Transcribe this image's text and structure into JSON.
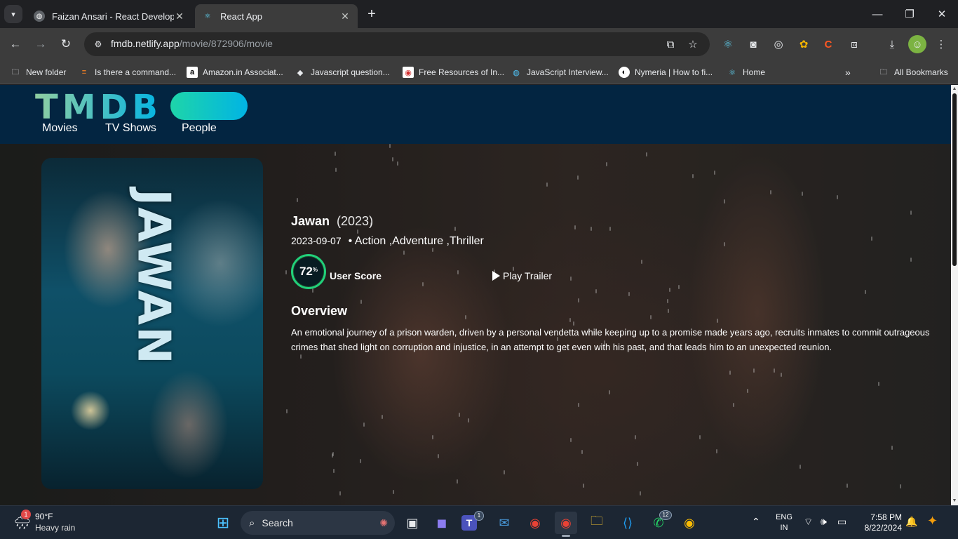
{
  "browser": {
    "tabs": [
      {
        "title": "Faizan Ansari - React Developer",
        "active": false
      },
      {
        "title": "React App",
        "active": true
      }
    ],
    "url_host": "fmdb.netlify.app",
    "url_path": "/movie/872906/movie",
    "bookmarks": [
      {
        "label": "New folder",
        "icon": "folder-icon"
      },
      {
        "label": "Is there a command...",
        "icon": "stackoverflow-icon"
      },
      {
        "label": "Amazon.in Associat...",
        "icon": "amazon-icon"
      },
      {
        "label": "Javascript question...",
        "icon": "dev-icon"
      },
      {
        "label": "Free Resources of In...",
        "icon": "resources-icon"
      },
      {
        "label": "JavaScript Interview...",
        "icon": "globe-icon"
      },
      {
        "label": "Nymeria | How to fi...",
        "icon": "nymeria-icon"
      },
      {
        "label": "Home",
        "icon": "react-icon"
      }
    ],
    "all_bookmarks": "All Bookmarks",
    "overflow": "»"
  },
  "site": {
    "logo": "TMDB",
    "nav": [
      "Movies",
      "TV Shows",
      "People"
    ]
  },
  "movie": {
    "title": "Jawan",
    "year": "(2023)",
    "release_date": "2023-09-07",
    "genres": "• Action ,Adventure ,Thriller",
    "score": "72",
    "score_suffix": "%",
    "score_label": "User Score",
    "play_trailer": "Play Trailer",
    "overview_heading": "Overview",
    "overview": "An emotional journey of a prison warden, driven by a personal vendetta while keeping up to a promise made years ago, recruits inmates to commit outrageous crimes that shed light on corruption and injustice, in an attempt to get even with his past, and that leads him to an unexpected reunion.",
    "poster_text": "JAWAN"
  },
  "taskbar": {
    "weather_temp": "90°F",
    "weather_desc": "Heavy rain",
    "weather_badge": "1",
    "search_label": "Search",
    "teams_badge": "1",
    "whatsapp_badge": "12",
    "lang_line1": "ENG",
    "lang_line2": "IN",
    "time": "7:58 PM",
    "date": "8/22/2024"
  },
  "colors": {
    "tmdb_navy": "#032541",
    "score_ring": "#21d07a",
    "chrome_dark": "#3c3c3c"
  }
}
